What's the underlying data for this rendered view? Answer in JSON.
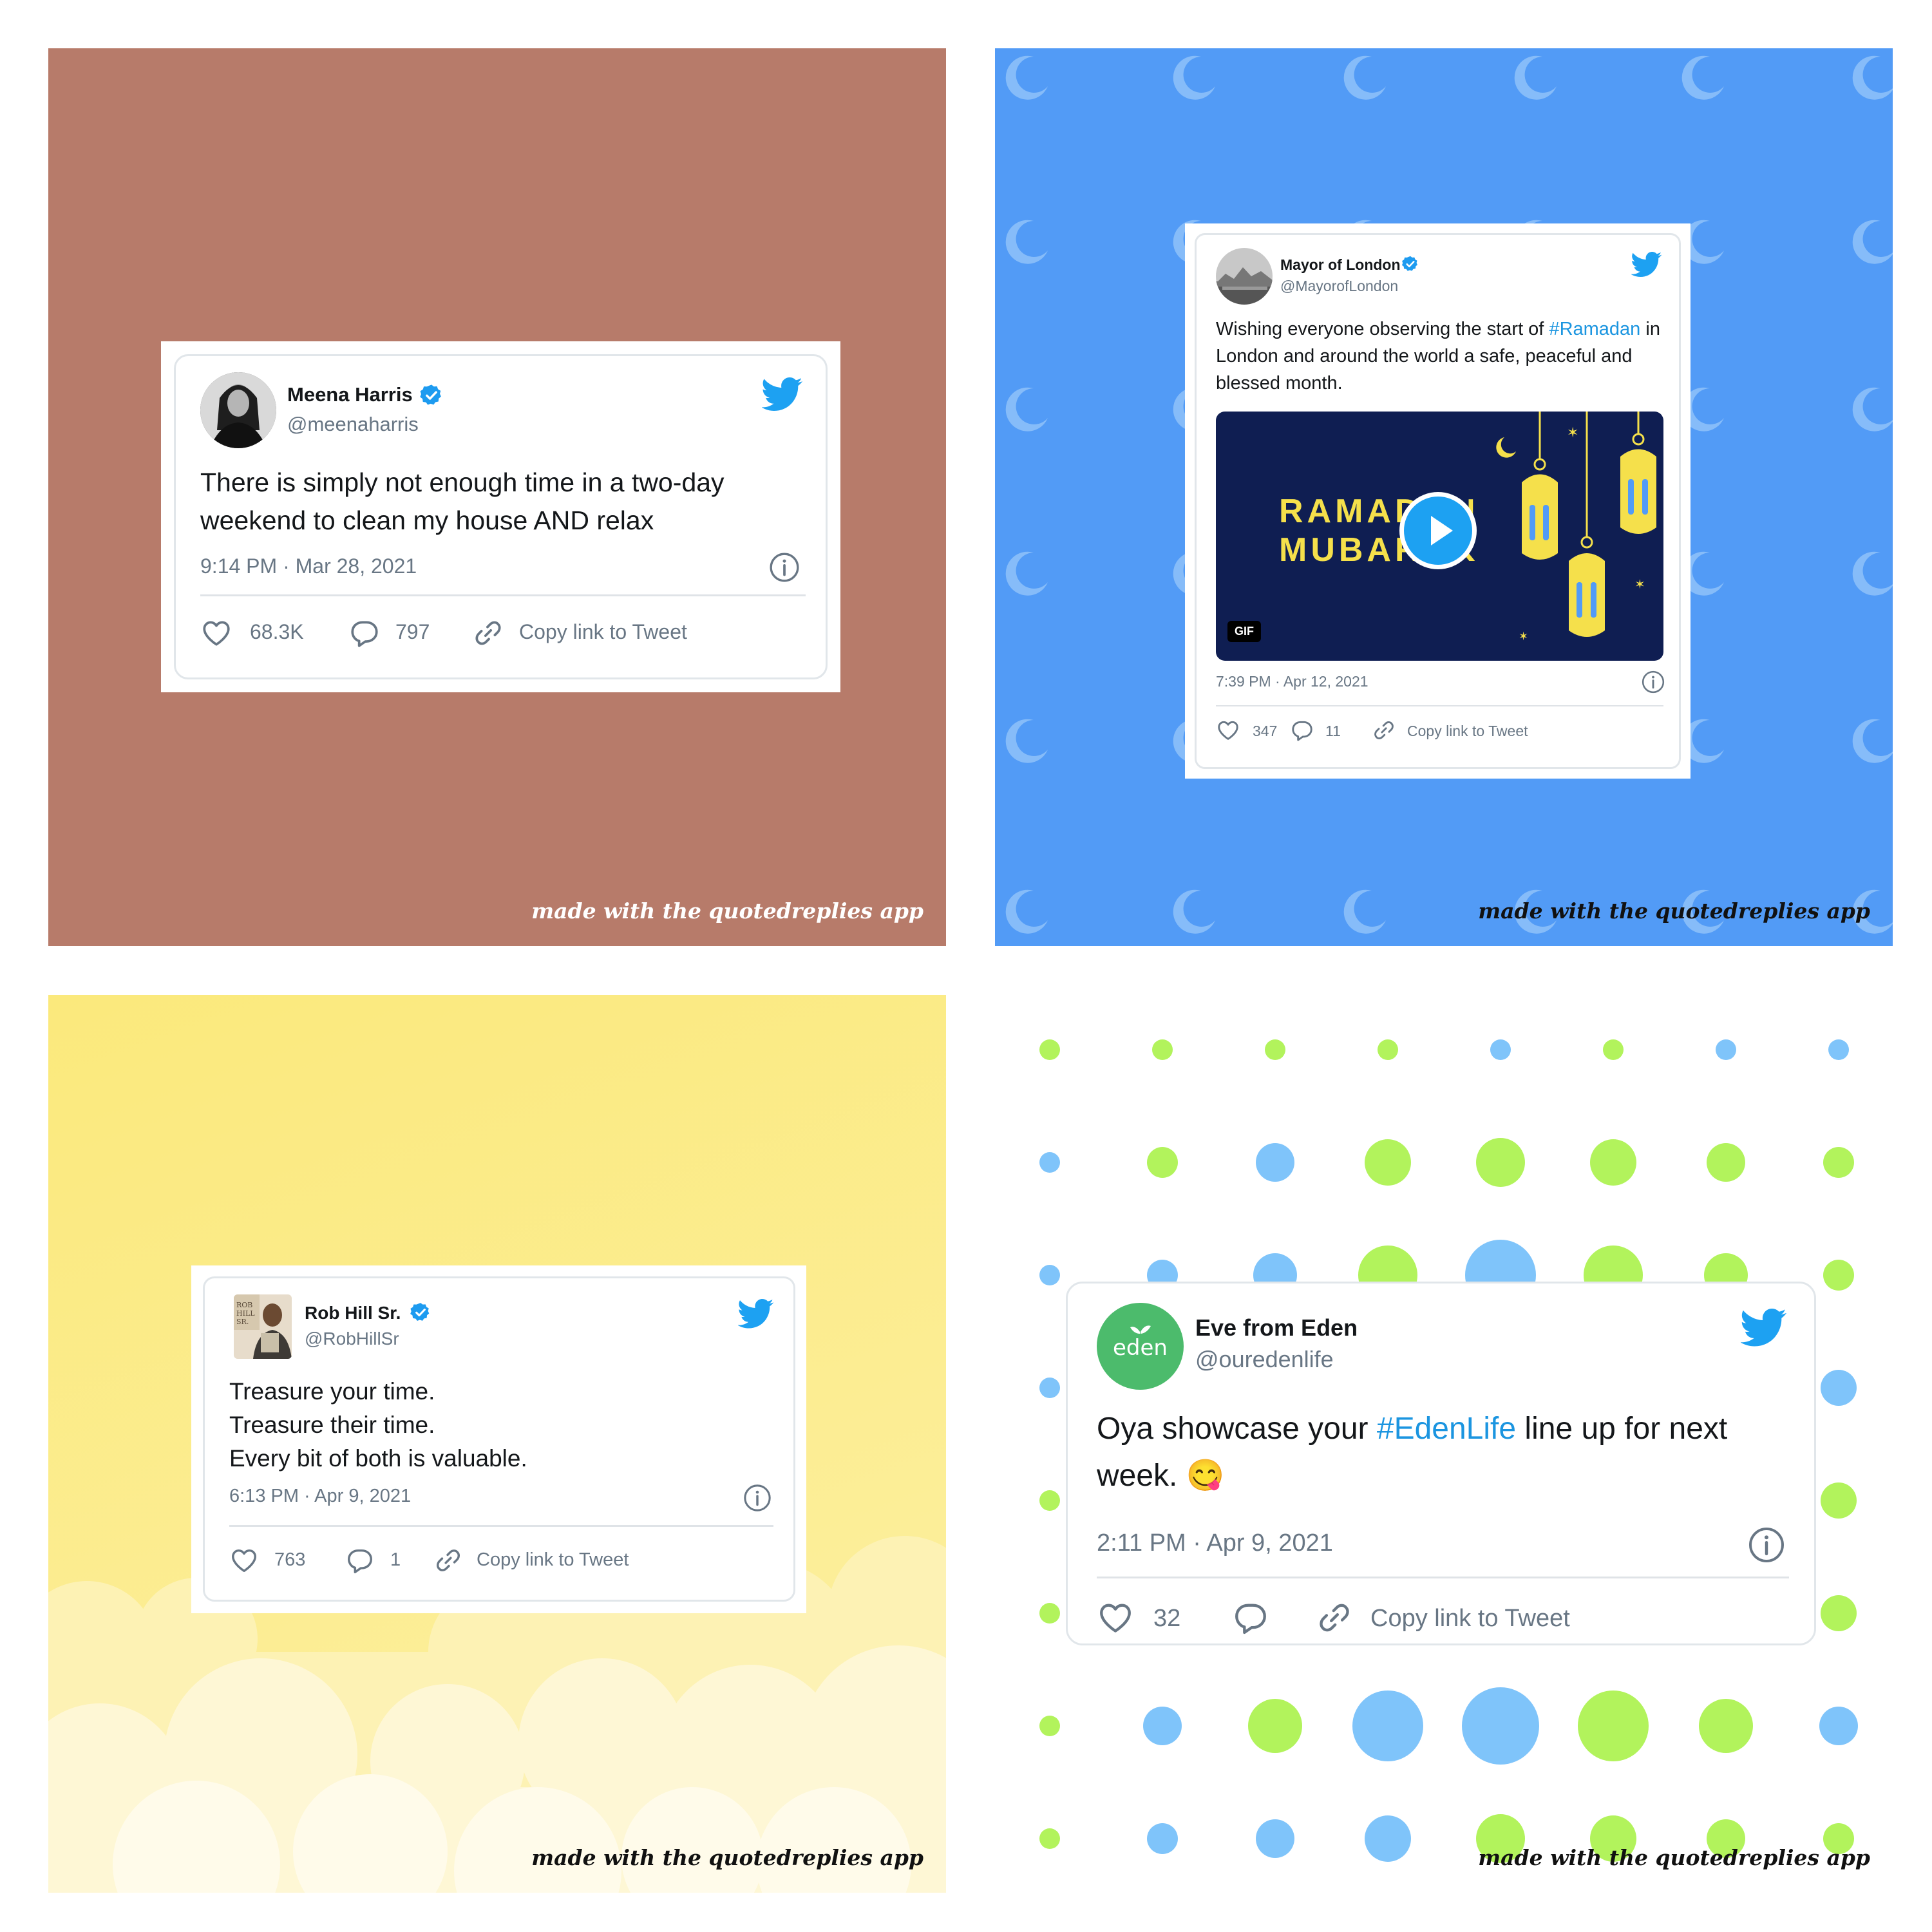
{
  "watermark": "made with the quotedreplies app",
  "colors": {
    "panel1_bg": "#b77b6a",
    "panel2_bg": "#529bf6",
    "panel3_bg": "#fbe98a",
    "twitter_blue": "#1da1f2",
    "hashtag": "#1b95e0",
    "dot_green": "#b2f35c",
    "dot_blue": "#7fc4fa"
  },
  "tweets": [
    {
      "name": "Meena Harris",
      "handle": "@meenaharris",
      "text": "There is simply not enough time in a two-day weekend to clean my house AND relax",
      "timestamp": "9:14 PM · Mar 28, 2021",
      "likes": "68.3K",
      "replies": "797",
      "copy_link": "Copy link to Tweet"
    },
    {
      "name": "Mayor of London",
      "handle": "@MayorofLondon",
      "text_before": "Wishing everyone observing the start of",
      "hashtag": "#Ramadan",
      "text_after": "in London and around the world a safe, peaceful and blessed month.",
      "media": {
        "line1": "RAMADAN",
        "line2": "MUBARAK",
        "badge": "GIF"
      },
      "timestamp": "7:39 PM · Apr 12, 2021",
      "likes": "347",
      "replies": "11",
      "copy_link": "Copy link to Tweet"
    },
    {
      "name": "Rob Hill Sr.",
      "handle": "@RobHillSr",
      "lines": [
        "Treasure your time.",
        "Treasure their time.",
        "Every bit of both is valuable."
      ],
      "timestamp": "6:13 PM · Apr 9, 2021",
      "likes": "763",
      "replies": "1",
      "copy_link": "Copy link to Tweet"
    },
    {
      "name": "Eve from Eden",
      "handle": "@ouredenlife",
      "avatar_text": "eden",
      "text_before": "Oya showcase your",
      "hashtag": "#EdenLife",
      "text_after": "line up for next week.",
      "emoji": "😋",
      "timestamp": "2:11 PM · Apr 9, 2021",
      "likes": "32",
      "copy_link": "Copy link to Tweet"
    }
  ]
}
